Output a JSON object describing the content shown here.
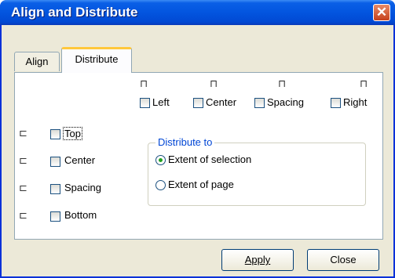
{
  "window": {
    "title": "Align and Distribute",
    "close_glyph": "✕"
  },
  "tabs": [
    {
      "label": "Align",
      "selected": false
    },
    {
      "label": "Distribute",
      "selected": true
    }
  ],
  "horizontal_options": [
    {
      "label": "Left",
      "icon": "distribute-left-icon",
      "glyph": "⊓",
      "checked": false
    },
    {
      "label": "Center",
      "icon": "distribute-center-horizontal-icon",
      "glyph": "⊓",
      "checked": false
    },
    {
      "label": "Spacing",
      "icon": "distribute-spacing-horizontal-icon",
      "glyph": "⊓",
      "checked": false
    },
    {
      "label": "Right",
      "icon": "distribute-right-icon",
      "glyph": "⊓",
      "checked": false
    }
  ],
  "vertical_options": [
    {
      "label": "Top",
      "icon": "distribute-top-icon",
      "glyph": "⊏",
      "checked": false
    },
    {
      "label": "Center",
      "icon": "distribute-center-vertical-icon",
      "glyph": "⊏",
      "checked": false
    },
    {
      "label": "Spacing",
      "icon": "distribute-spacing-vertical-icon",
      "glyph": "⊏",
      "checked": false
    },
    {
      "label": "Bottom",
      "icon": "distribute-bottom-icon",
      "glyph": "⊏",
      "checked": false
    }
  ],
  "distribute_to": {
    "legend": "Distribute to",
    "options": [
      {
        "label": "Extent of selection",
        "selected": true
      },
      {
        "label": "Extent of page",
        "selected": false
      }
    ]
  },
  "buttons": {
    "apply": "Apply",
    "close": "Close"
  },
  "colors": {
    "title_bar": "#0355df",
    "panel": "#ffffff",
    "dialog": "#ece9d8",
    "group_legend": "#0046d5",
    "radio_dot": "#21a121"
  }
}
